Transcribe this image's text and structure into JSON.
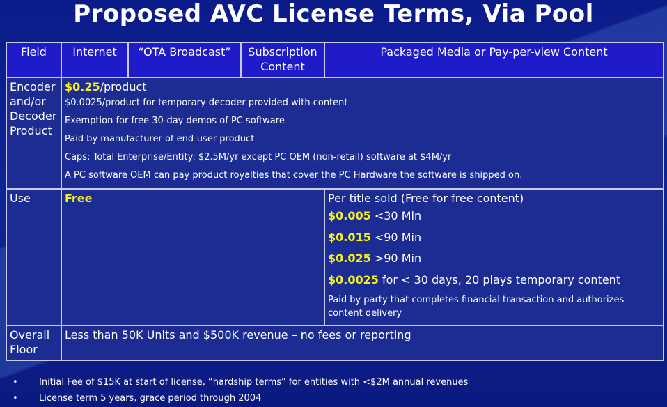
{
  "title": "Proposed AVC License Terms, Via Pool",
  "headers": {
    "field": "Field",
    "internet": "Internet",
    "ota": "“OTA Broadcast”",
    "subscription": "Subscription Content",
    "packaged": "Packaged Media or Pay-per-view Content"
  },
  "encoder": {
    "label": "Encoder and/or Decoder Product",
    "price": "$0.25",
    "price_unit": "/product",
    "lines": [
      "$0.0025/product for temporary decoder provided with content",
      "Exemption for free 30-day demos of PC software",
      "Paid by manufacturer of end-user product",
      "Caps: Total Enterprise/Entity: $2.5M/yr except PC OEM (non-retail) software at $4M/yr",
      "A PC software OEM can pay product royalties that cover the PC Hardware the software is shipped on."
    ]
  },
  "use": {
    "label": "Use",
    "free": "Free",
    "per_title": "Per title sold (Free for free content)",
    "prices": [
      {
        "price": "$0.005",
        "desc": "<30 Min"
      },
      {
        "price": "$0.015",
        "desc": "<90 Min"
      },
      {
        "price": "$0.025",
        "desc": ">90 Min"
      },
      {
        "price": "$0.0025",
        "desc": "for < 30 days, 20 plays  temporary content"
      }
    ],
    "paid_by": "Paid by party that completes financial transaction and authorizes content delivery"
  },
  "floor": {
    "label": "Overall Floor",
    "text": "Less than 50K Units and $500K revenue – no fees or reporting"
  },
  "bullets": [
    "Initial Fee of $15K at start of license, “hardship terms” for entities with <$2M annual revenues",
    "License term 5 years, grace period through 2004"
  ]
}
